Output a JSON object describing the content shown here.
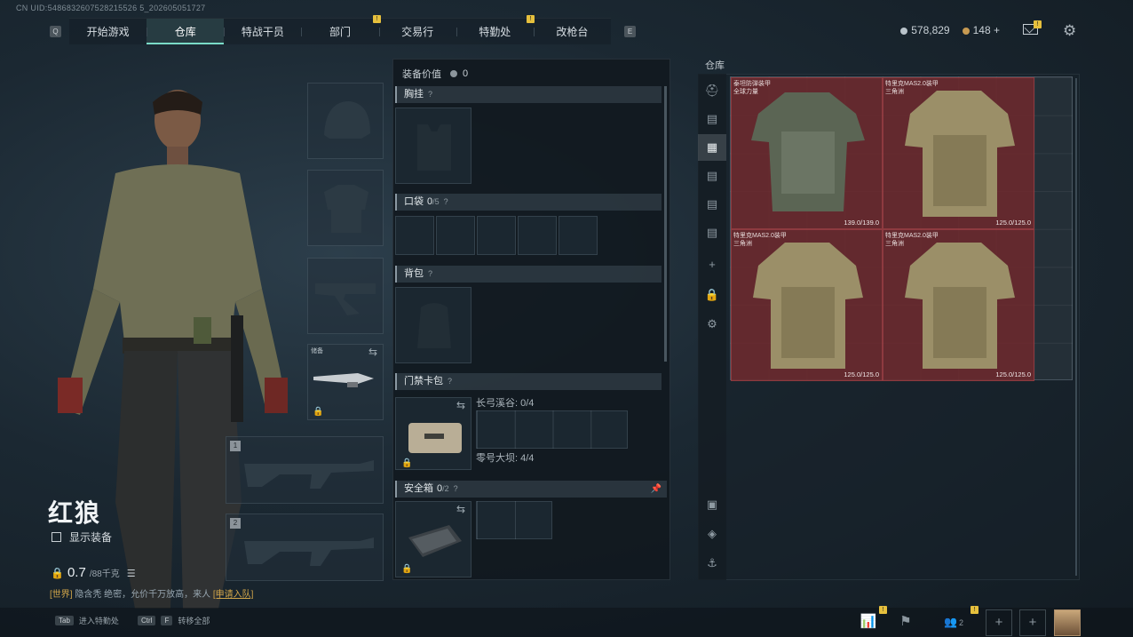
{
  "uid_text": "CN UID:5486832607528215526 5_202605051727",
  "nav": {
    "key_left": "Q",
    "key_right": "E",
    "tabs": [
      {
        "label": "开始游戏",
        "active": false
      },
      {
        "label": "仓库",
        "active": true
      },
      {
        "label": "特战干员",
        "active": false
      },
      {
        "label": "部门",
        "active": false
      },
      {
        "label": "交易行",
        "active": false
      },
      {
        "label": "特勤处",
        "active": false
      },
      {
        "label": "改枪台",
        "active": false
      }
    ],
    "badges": [
      "!",
      "!"
    ]
  },
  "currency": {
    "silver": "578,829",
    "gold": "148",
    "gold_add": "+",
    "silver_color": "#b9c3ca",
    "gold_color": "#c79a52"
  },
  "operator": {
    "name": "红狼",
    "show_gear_label": "显示装备",
    "weight_value": "0.7",
    "weight_max": "/88千克",
    "melee_label": "储备",
    "slot1_num": "1",
    "slot2_num": "2"
  },
  "chat": {
    "channel": "[世界]",
    "message": "隐含秃 绝密，允价千万放高，来人",
    "link": "[申请入队]"
  },
  "loadout": {
    "gear_value_label": "装备价值",
    "gear_value": "0",
    "chest_rig_label": "胸挂",
    "pocket_label": "口袋",
    "pocket_count": "0",
    "pocket_max": "/5",
    "backpack_label": "背包",
    "keycard_label": "门禁卡包",
    "keycard_map1": "长弓溪谷: 0/4",
    "keycard_map2": "零号大坝: 4/4",
    "safebox_label": "安全箱",
    "safebox_count": "0",
    "safebox_max": "/2",
    "help_mark": "?"
  },
  "stash": {
    "title": "仓库",
    "items": [
      {
        "name_line1": "泰坦防弹装甲",
        "name_line2": "全球力量",
        "durability": "139.0/139.0"
      },
      {
        "name_line1": "特里克MAS2.0装甲",
        "name_line2": "三角洲",
        "durability": "125.0/125.0"
      },
      {
        "name_line1": "特里克MAS2.0装甲",
        "name_line2": "三角洲",
        "durability": "125.0/125.0"
      },
      {
        "name_line1": "特里克MAS2.0装甲",
        "name_line2": "三角洲",
        "durability": "125.0/125.0"
      }
    ],
    "side_add": "+"
  },
  "bottom": {
    "hint1_key": "Tab",
    "hint1_label": "进入特勤处",
    "hint2_key1": "Ctrl",
    "hint2_key2": "F",
    "hint2_label": "转移全部",
    "squad_count": "2",
    "add_slot": "+"
  }
}
